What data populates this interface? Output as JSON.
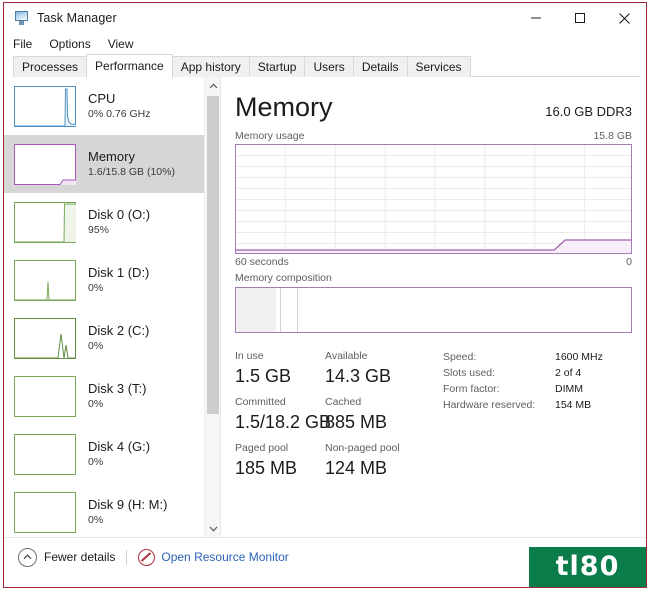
{
  "window": {
    "title": "Task Manager",
    "icon": "task-manager-icon",
    "controls": {
      "minimize": "─",
      "maximize": "□",
      "close": "✕"
    }
  },
  "menu": {
    "items": [
      "File",
      "Options",
      "View"
    ]
  },
  "tabs": [
    {
      "label": "Processes",
      "active": false
    },
    {
      "label": "Performance",
      "active": true
    },
    {
      "label": "App history",
      "active": false
    },
    {
      "label": "Startup",
      "active": false
    },
    {
      "label": "Users",
      "active": false
    },
    {
      "label": "Details",
      "active": false
    },
    {
      "label": "Services",
      "active": false
    }
  ],
  "sidebar": {
    "items": [
      {
        "name": "CPU",
        "sub": "0%  0.76 GHz",
        "color": "#4a90c4",
        "selected": false
      },
      {
        "name": "Memory",
        "sub": "1.6/15.8 GB (10%)",
        "color": "#a858b8",
        "selected": true
      },
      {
        "name": "Disk 0 (O:)",
        "sub": "95%",
        "color": "#77a858",
        "selected": false
      },
      {
        "name": "Disk 1 (D:)",
        "sub": "0%",
        "color": "#77a858",
        "selected": false
      },
      {
        "name": "Disk 2 (C:)",
        "sub": "0%",
        "color": "#5f8f3f",
        "selected": false
      },
      {
        "name": "Disk 3 (T:)",
        "sub": "0%",
        "color": "#77a858",
        "selected": false
      },
      {
        "name": "Disk 4 (G:)",
        "sub": "0%",
        "color": "#77a858",
        "selected": false
      },
      {
        "name": "Disk 9 (H: M:)",
        "sub": "0%",
        "color": "#77a858",
        "selected": false
      }
    ],
    "scrollbar": {
      "up": "⌃",
      "down": "⌄"
    }
  },
  "main": {
    "title": "Memory",
    "spec": "16.0 GB DDR3",
    "usage_graph": {
      "caption": "Memory usage",
      "max_label": "15.8 GB",
      "x_left_label": "60 seconds",
      "x_right_label": "0",
      "accent": "#a47db0"
    },
    "composition": {
      "caption": "Memory composition"
    },
    "stats": [
      [
        {
          "label": "In use",
          "value": "1.5 GB"
        },
        {
          "label": "Available",
          "value": "14.3 GB"
        }
      ],
      [
        {
          "label": "Committed",
          "value": "1.5/18.2 GB"
        },
        {
          "label": "Cached",
          "value": "885 MB"
        }
      ],
      [
        {
          "label": "Paged pool",
          "value": "185 MB"
        },
        {
          "label": "Non-paged pool",
          "value": "124 MB"
        }
      ]
    ],
    "hardware": [
      {
        "label": "Speed:",
        "value": "1600 MHz"
      },
      {
        "label": "Slots used:",
        "value": "2 of 4"
      },
      {
        "label": "Form factor:",
        "value": "DIMM"
      },
      {
        "label": "Hardware reserved:",
        "value": "154 MB"
      }
    ]
  },
  "footer": {
    "fewer_details": "Fewer details",
    "resource_monitor": "Open Resource Monitor"
  },
  "watermark": {
    "text": "tl80",
    "color": "#0b7d4a"
  }
}
